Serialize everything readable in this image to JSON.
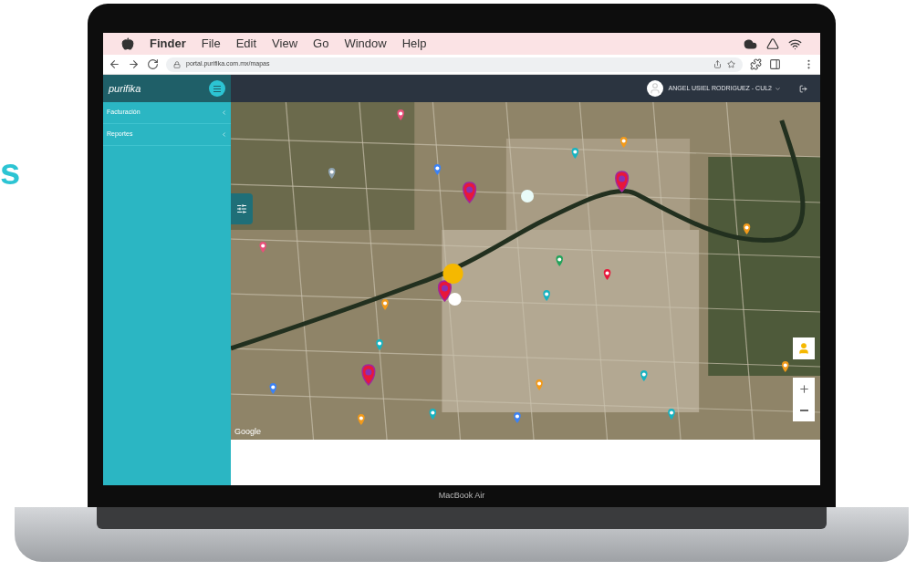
{
  "backdrop_text": "s",
  "menu_bar": {
    "app": "Finder",
    "items": [
      "File",
      "Edit",
      "View",
      "Go",
      "Window",
      "Help"
    ]
  },
  "browser": {
    "url": "portal.purifika.com.mx/mapas"
  },
  "app": {
    "logo": "purifika",
    "user": "ANGEL USIEL RODRIGUEZ - CUL2",
    "sidebar": [
      {
        "label": "Facturación"
      },
      {
        "label": "Reportes"
      }
    ]
  },
  "map": {
    "attribution": "Google"
  },
  "device": {
    "label": "MacBook Air"
  }
}
